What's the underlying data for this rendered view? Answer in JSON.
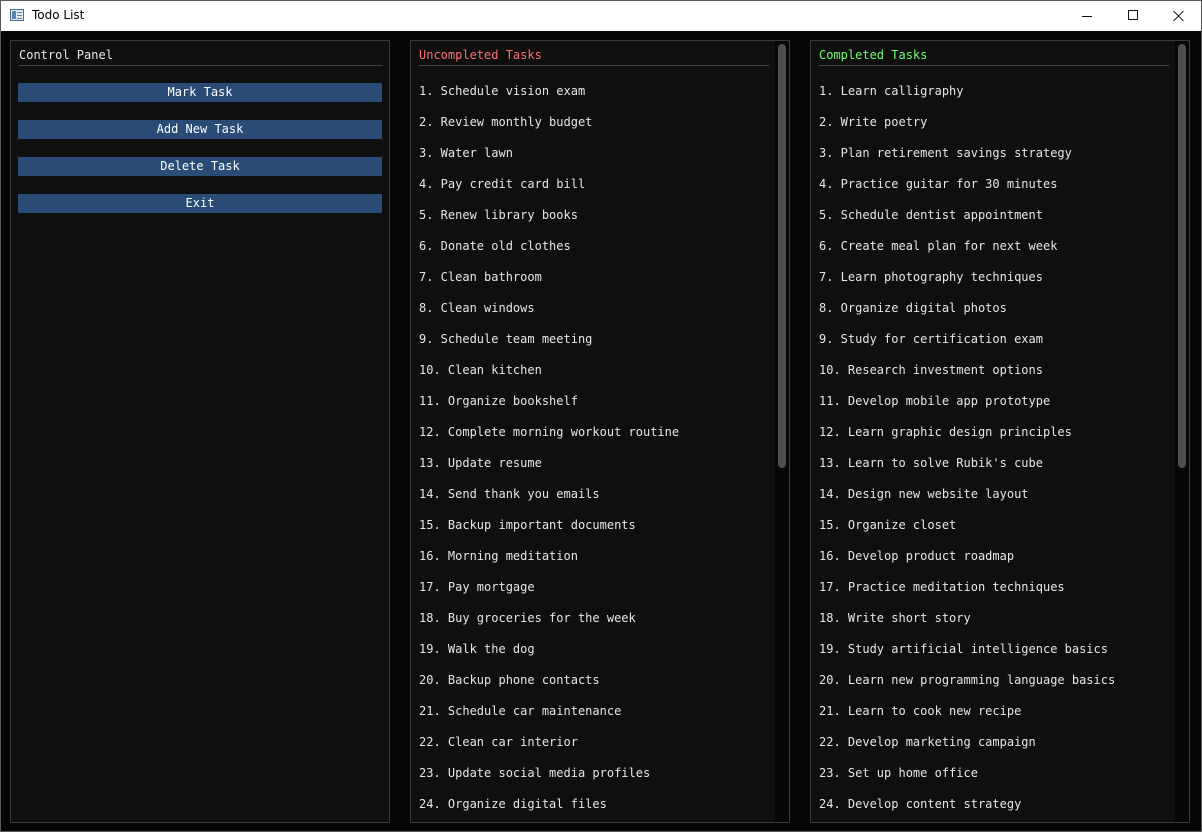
{
  "window": {
    "title": "Todo List",
    "controls": {
      "minimize_icon": "minimize-icon",
      "maximize_icon": "maximize-icon",
      "close_icon": "close-icon"
    }
  },
  "colors": {
    "uncompleted_header": "#ff6f6f",
    "completed_header": "#72ff72",
    "control_header": "#e6e6e6",
    "button_bg": "#2a4b75"
  },
  "control_panel": {
    "title": "Control Panel",
    "buttons": [
      "Mark Task",
      "Add New Task",
      "Delete Task",
      "Exit"
    ]
  },
  "uncompleted": {
    "title": "Uncompleted Tasks",
    "scroll_thumb_fraction": 0.55,
    "scroll_position": 0,
    "items": [
      "1. Schedule vision exam",
      "2. Review monthly budget",
      "3. Water lawn",
      "4. Pay credit card bill",
      "5. Renew library books",
      "6. Donate old clothes",
      "7. Clean bathroom",
      "8. Clean windows",
      "9. Schedule team meeting",
      "10. Clean kitchen",
      "11. Organize bookshelf",
      "12. Complete morning workout routine",
      "13. Update resume",
      "14. Send thank you emails",
      "15. Backup important documents",
      "16. Morning meditation",
      "17. Pay mortgage",
      "18. Buy groceries for the week",
      "19. Walk the dog",
      "20. Backup phone contacts",
      "21. Schedule car maintenance",
      "22. Clean car interior",
      "23. Update social media profiles",
      "24. Organize digital files"
    ]
  },
  "completed": {
    "title": "Completed Tasks",
    "scroll_thumb_fraction": 0.55,
    "scroll_position": 0,
    "items": [
      "1. Learn calligraphy",
      "2. Write poetry",
      "3. Plan retirement savings strategy",
      "4. Practice guitar for 30 minutes",
      "5. Schedule dentist appointment",
      "6. Create meal plan for next week",
      "7. Learn photography techniques",
      "8. Organize digital photos",
      "9. Study for certification exam",
      "10. Research investment options",
      "11. Develop mobile app prototype",
      "12. Learn graphic design principles",
      "13. Learn to solve Rubik's cube",
      "14. Design new website layout",
      "15. Organize closet",
      "16. Develop product roadmap",
      "17. Practice meditation techniques",
      "18. Write short story",
      "19. Study artificial intelligence basics",
      "20. Learn new programming language basics",
      "21. Learn to cook new recipe",
      "22. Develop marketing campaign",
      "23. Set up home office",
      "24. Develop content strategy"
    ]
  }
}
